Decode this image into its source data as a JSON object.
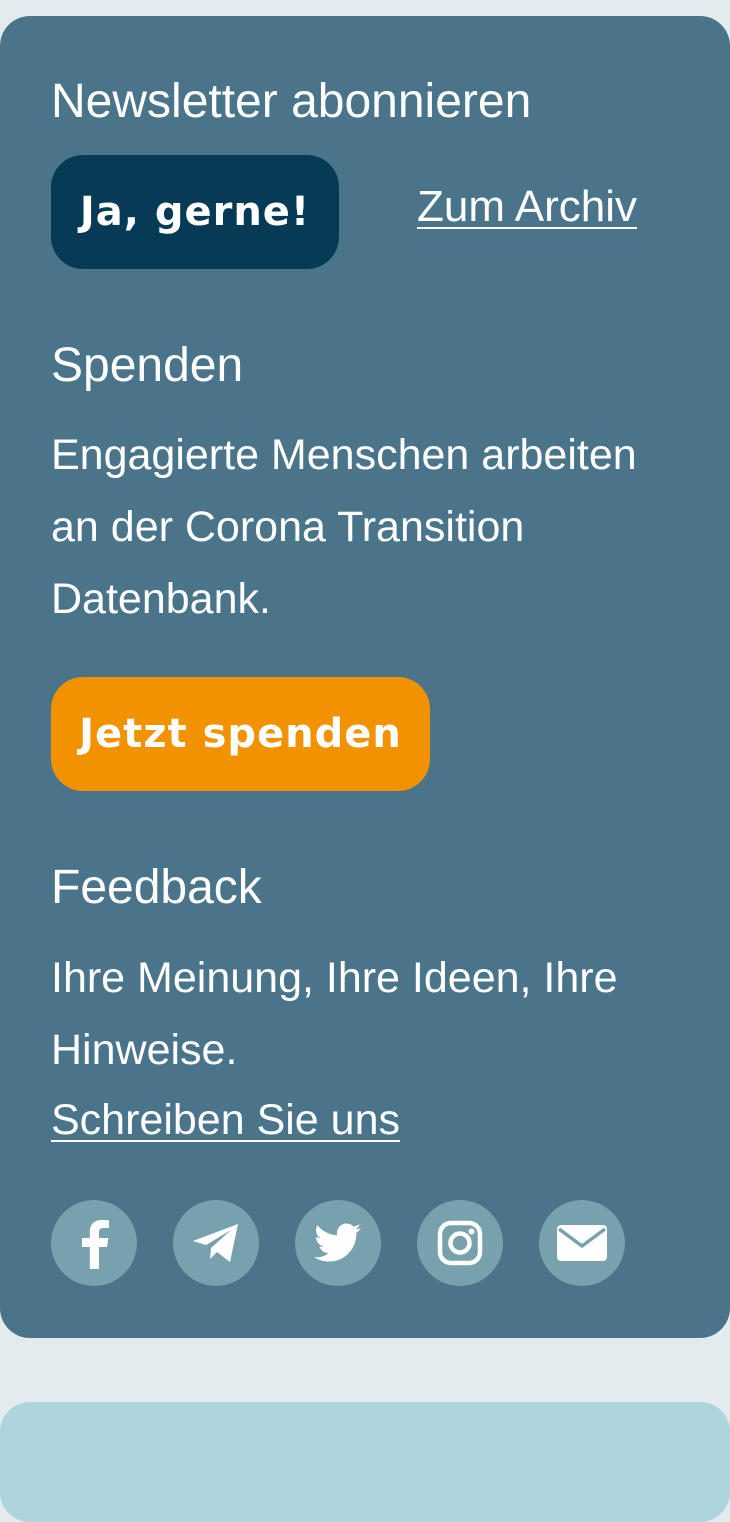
{
  "newsletter": {
    "heading": "Newsletter abonnieren",
    "subscribe_label": "Ja, gerne!",
    "archive_link": "Zum Archiv"
  },
  "donate": {
    "heading": "Spenden",
    "text": "Engagierte Menschen arbeiten an der Corona Transition Datenbank.",
    "button_label": "Jetzt spenden"
  },
  "feedback": {
    "heading": "Feedback",
    "text": "Ihre Meinung, Ihre Ideen, Ihre Hinweise.",
    "link": "Schreiben Sie uns"
  },
  "social": {
    "icons": [
      "facebook-icon",
      "telegram-icon",
      "twitter-icon",
      "instagram-icon",
      "mail-icon"
    ]
  },
  "colors": {
    "panel_bg": "#4a7489",
    "page_bg": "#e3ebee",
    "newsletter_button": "#073b55",
    "donate_button": "#f29200",
    "social_circle": "#77a1ac",
    "next_card": "#aed4dc"
  }
}
